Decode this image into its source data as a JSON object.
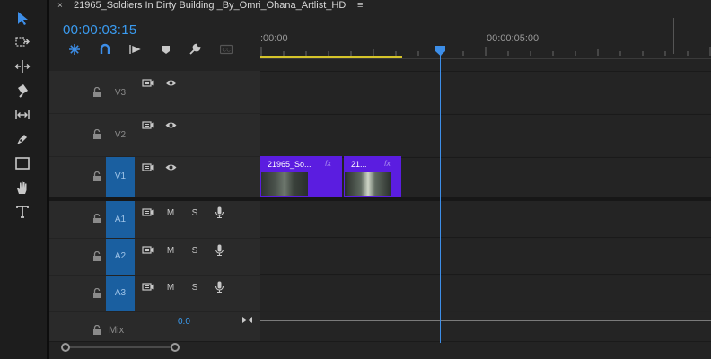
{
  "sequence": {
    "title": "21965_Soldiers In Dirty Building _By_Omri_Ohana_Artlist_HD",
    "close_glyph": "×",
    "menu_glyph": "≡",
    "timecode": "00:00:03:15"
  },
  "ruler": {
    "labels": [
      ":00:00",
      "00:00:05:00"
    ]
  },
  "video_tracks": [
    {
      "label": "V3"
    },
    {
      "label": "V2"
    },
    {
      "label": "V1"
    }
  ],
  "audio_tracks": [
    {
      "label": "A1",
      "mute": "M",
      "solo": "S"
    },
    {
      "label": "A2",
      "mute": "M",
      "solo": "S"
    },
    {
      "label": "A3",
      "mute": "M",
      "solo": "S"
    }
  ],
  "mix": {
    "label": "Mix",
    "value": "0.0"
  },
  "clips": [
    {
      "name": "21965_So...",
      "fx": "fx"
    },
    {
      "name": "21...",
      "fx": "fx"
    }
  ],
  "playhead_position": "00:00:03:15",
  "colors": {
    "accent_blue": "#3a9bf0",
    "clip_purple": "#5b1de0",
    "work_area_yellow": "#d5c42a",
    "track_target": "#1a5fa0"
  },
  "icons": {
    "tools": [
      "selection-tool-icon",
      "track-select-icon",
      "ripple-edit-icon",
      "razor-icon",
      "slip-icon",
      "pen-icon",
      "rectangle-icon",
      "hand-icon",
      "type-icon"
    ],
    "header": [
      "snap-icon",
      "linked-selection-icon",
      "add-marker-icon",
      "marker-icon",
      "settings-wrench-icon",
      "captions-icon"
    ]
  }
}
